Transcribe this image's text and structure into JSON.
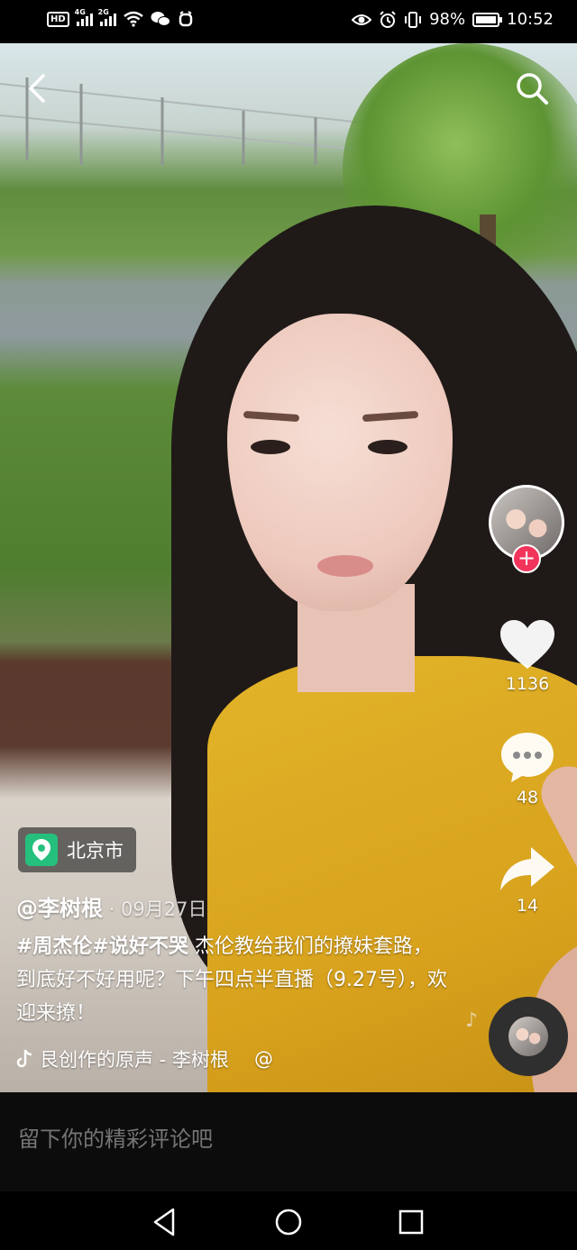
{
  "status_bar": {
    "network_badge": "HD",
    "signal_1_label": "4G",
    "signal_2_label": "2G",
    "battery": "98%",
    "battery_level": 0.98,
    "time": "10:52"
  },
  "video": {
    "location": "北京市",
    "author": "@李树根",
    "date_separator": " · ",
    "date": "09月27日",
    "caption_tags": "#周杰伦#说好不哭",
    "caption_text": " 杰伦教给我们的撩妹套路，到底好不好用呢？下午四点半直播（9.27号），欢迎来撩！",
    "music": "艮创作的原声 - 李树根",
    "music_at": "@"
  },
  "actions": {
    "follow_label": "+",
    "likes": "1136",
    "comments": "48",
    "shares": "14"
  },
  "comment_input": {
    "placeholder": "留下你的精彩评论吧"
  },
  "colors": {
    "follow": "#f2345b",
    "location": "#25c07d"
  }
}
